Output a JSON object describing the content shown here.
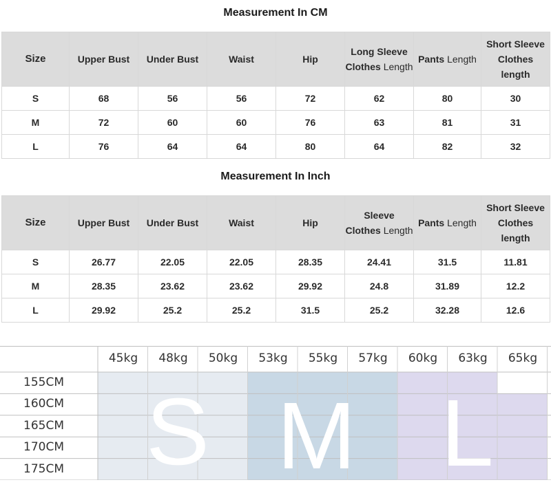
{
  "cm": {
    "title": "Measurement In CM",
    "headers": {
      "size": "Size",
      "upper_bust": "Upper Bust",
      "under_bust": "Under Bust",
      "waist": "Waist",
      "hip": "Hip",
      "long_sleeve_a": "Long Sleeve",
      "long_sleeve_b": "Clothes",
      "long_sleeve_c": "Length",
      "pants_a": "Pants",
      "pants_b": "Length",
      "short_a": "Short Sleeve",
      "short_b": "Clothes",
      "short_c": "length"
    },
    "rows": [
      [
        "S",
        "68",
        "56",
        "56",
        "72",
        "62",
        "80",
        "30"
      ],
      [
        "M",
        "72",
        "60",
        "60",
        "76",
        "63",
        "81",
        "31"
      ],
      [
        "L",
        "76",
        "64",
        "64",
        "80",
        "64",
        "82",
        "32"
      ]
    ]
  },
  "inch": {
    "title": "Measurement In Inch",
    "headers": {
      "size": "Size",
      "upper_bust": "Upper Bust",
      "under_bust": "Under Bust",
      "waist": "Waist",
      "hip": "Hip",
      "sleeve_a": "Sleeve",
      "sleeve_b": "Clothes",
      "sleeve_c": "Length",
      "pants_a": "Pants",
      "pants_b": "Length",
      "short_a": "Short Sleeve",
      "short_b": "Clothes",
      "short_c": "length"
    },
    "rows": [
      [
        "S",
        "26.77",
        "22.05",
        "22.05",
        "28.35",
        "24.41",
        "31.5",
        "11.81"
      ],
      [
        "M",
        "28.35",
        "23.62",
        "23.62",
        "29.92",
        "24.8",
        "31.89",
        "12.2"
      ],
      [
        "L",
        "29.92",
        "25.2",
        "25.2",
        "31.5",
        "25.2",
        "32.28",
        "12.6"
      ]
    ]
  },
  "size_grid": {
    "weights": [
      "45kg",
      "48kg",
      "50kg",
      "53kg",
      "55kg",
      "57kg",
      "60kg",
      "63kg",
      "65kg"
    ],
    "heights": [
      "155CM",
      "160CM",
      "165CM",
      "170CM",
      "175CM"
    ],
    "sizes": [
      {
        "label": "S",
        "weight_cols": 3,
        "color": "#e6ebf1"
      },
      {
        "label": "M",
        "weight_cols": 3,
        "color": "#c8d8e5"
      },
      {
        "label": "L",
        "weight_cols": 3,
        "color": "#ddd9ee"
      }
    ]
  }
}
